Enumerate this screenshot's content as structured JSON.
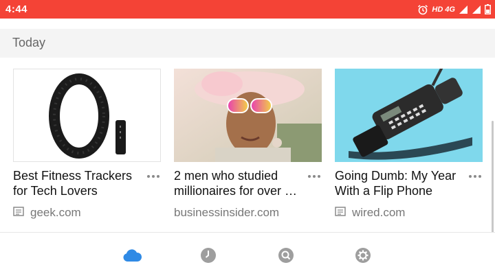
{
  "status_bar": {
    "time": "4:44",
    "network_label": "HD 4G",
    "icons": [
      "alarm-icon",
      "signal-icon",
      "signal-icon",
      "battery-icon"
    ],
    "background": "#f44336"
  },
  "section": {
    "title": "Today"
  },
  "cards": [
    {
      "title": "Best Fitness Trackers for Tech Lovers",
      "source": "geek.com",
      "image": "fitness-tracker-image"
    },
    {
      "title": "2 men who studied millionaires for over …",
      "source": "businessinsider.com",
      "image": "woman-in-hat-image"
    },
    {
      "title": "Going Dumb: My Year With a Flip Phone",
      "source": "wired.com",
      "image": "flip-phone-image"
    }
  ],
  "bottom_nav": {
    "items": [
      {
        "icon": "cloud-icon",
        "active": true
      },
      {
        "icon": "clock-icon",
        "active": false
      },
      {
        "icon": "search-icon",
        "active": false
      },
      {
        "icon": "gear-icon",
        "active": false
      }
    ],
    "active_color": "#2f8ae5",
    "inactive_color": "#9e9e9e"
  }
}
